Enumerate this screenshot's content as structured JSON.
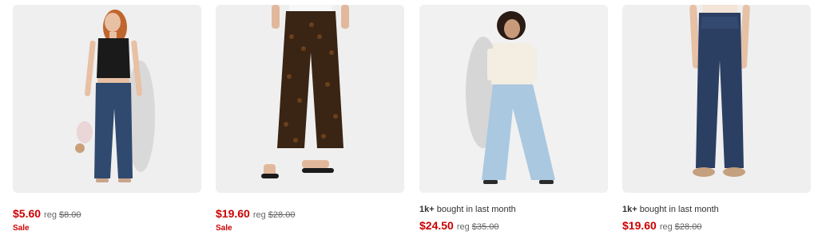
{
  "products": [
    {
      "image_label": "woman in black lace camisole and dark wash flare jeans",
      "price": "$5.60",
      "reg_label": "reg",
      "reg_price": "$8.00",
      "badge": "Sale",
      "social_proof": ""
    },
    {
      "image_label": "brown patterned wide-leg pants with black sandals",
      "price": "$19.60",
      "reg_label": "reg",
      "reg_price": "$28.00",
      "badge": "Sale",
      "social_proof": ""
    },
    {
      "image_label": "woman in cream top and light wash wide-leg jeans",
      "price": "$24.50",
      "reg_label": "reg",
      "reg_price": "$35.00",
      "badge": "",
      "social_proof_bold": "1k+",
      "social_proof": "bought in last month"
    },
    {
      "image_label": "dark wash bootcut jeans with tan flats",
      "price": "$19.60",
      "reg_label": "reg",
      "reg_price": "$28.00",
      "badge": "",
      "social_proof_bold": "1k+",
      "social_proof": "bought in last month"
    }
  ],
  "colors": {
    "sale_red": "#cc0000",
    "image_bg": "#eeeeee",
    "text": "#333333",
    "muted": "#666666"
  }
}
